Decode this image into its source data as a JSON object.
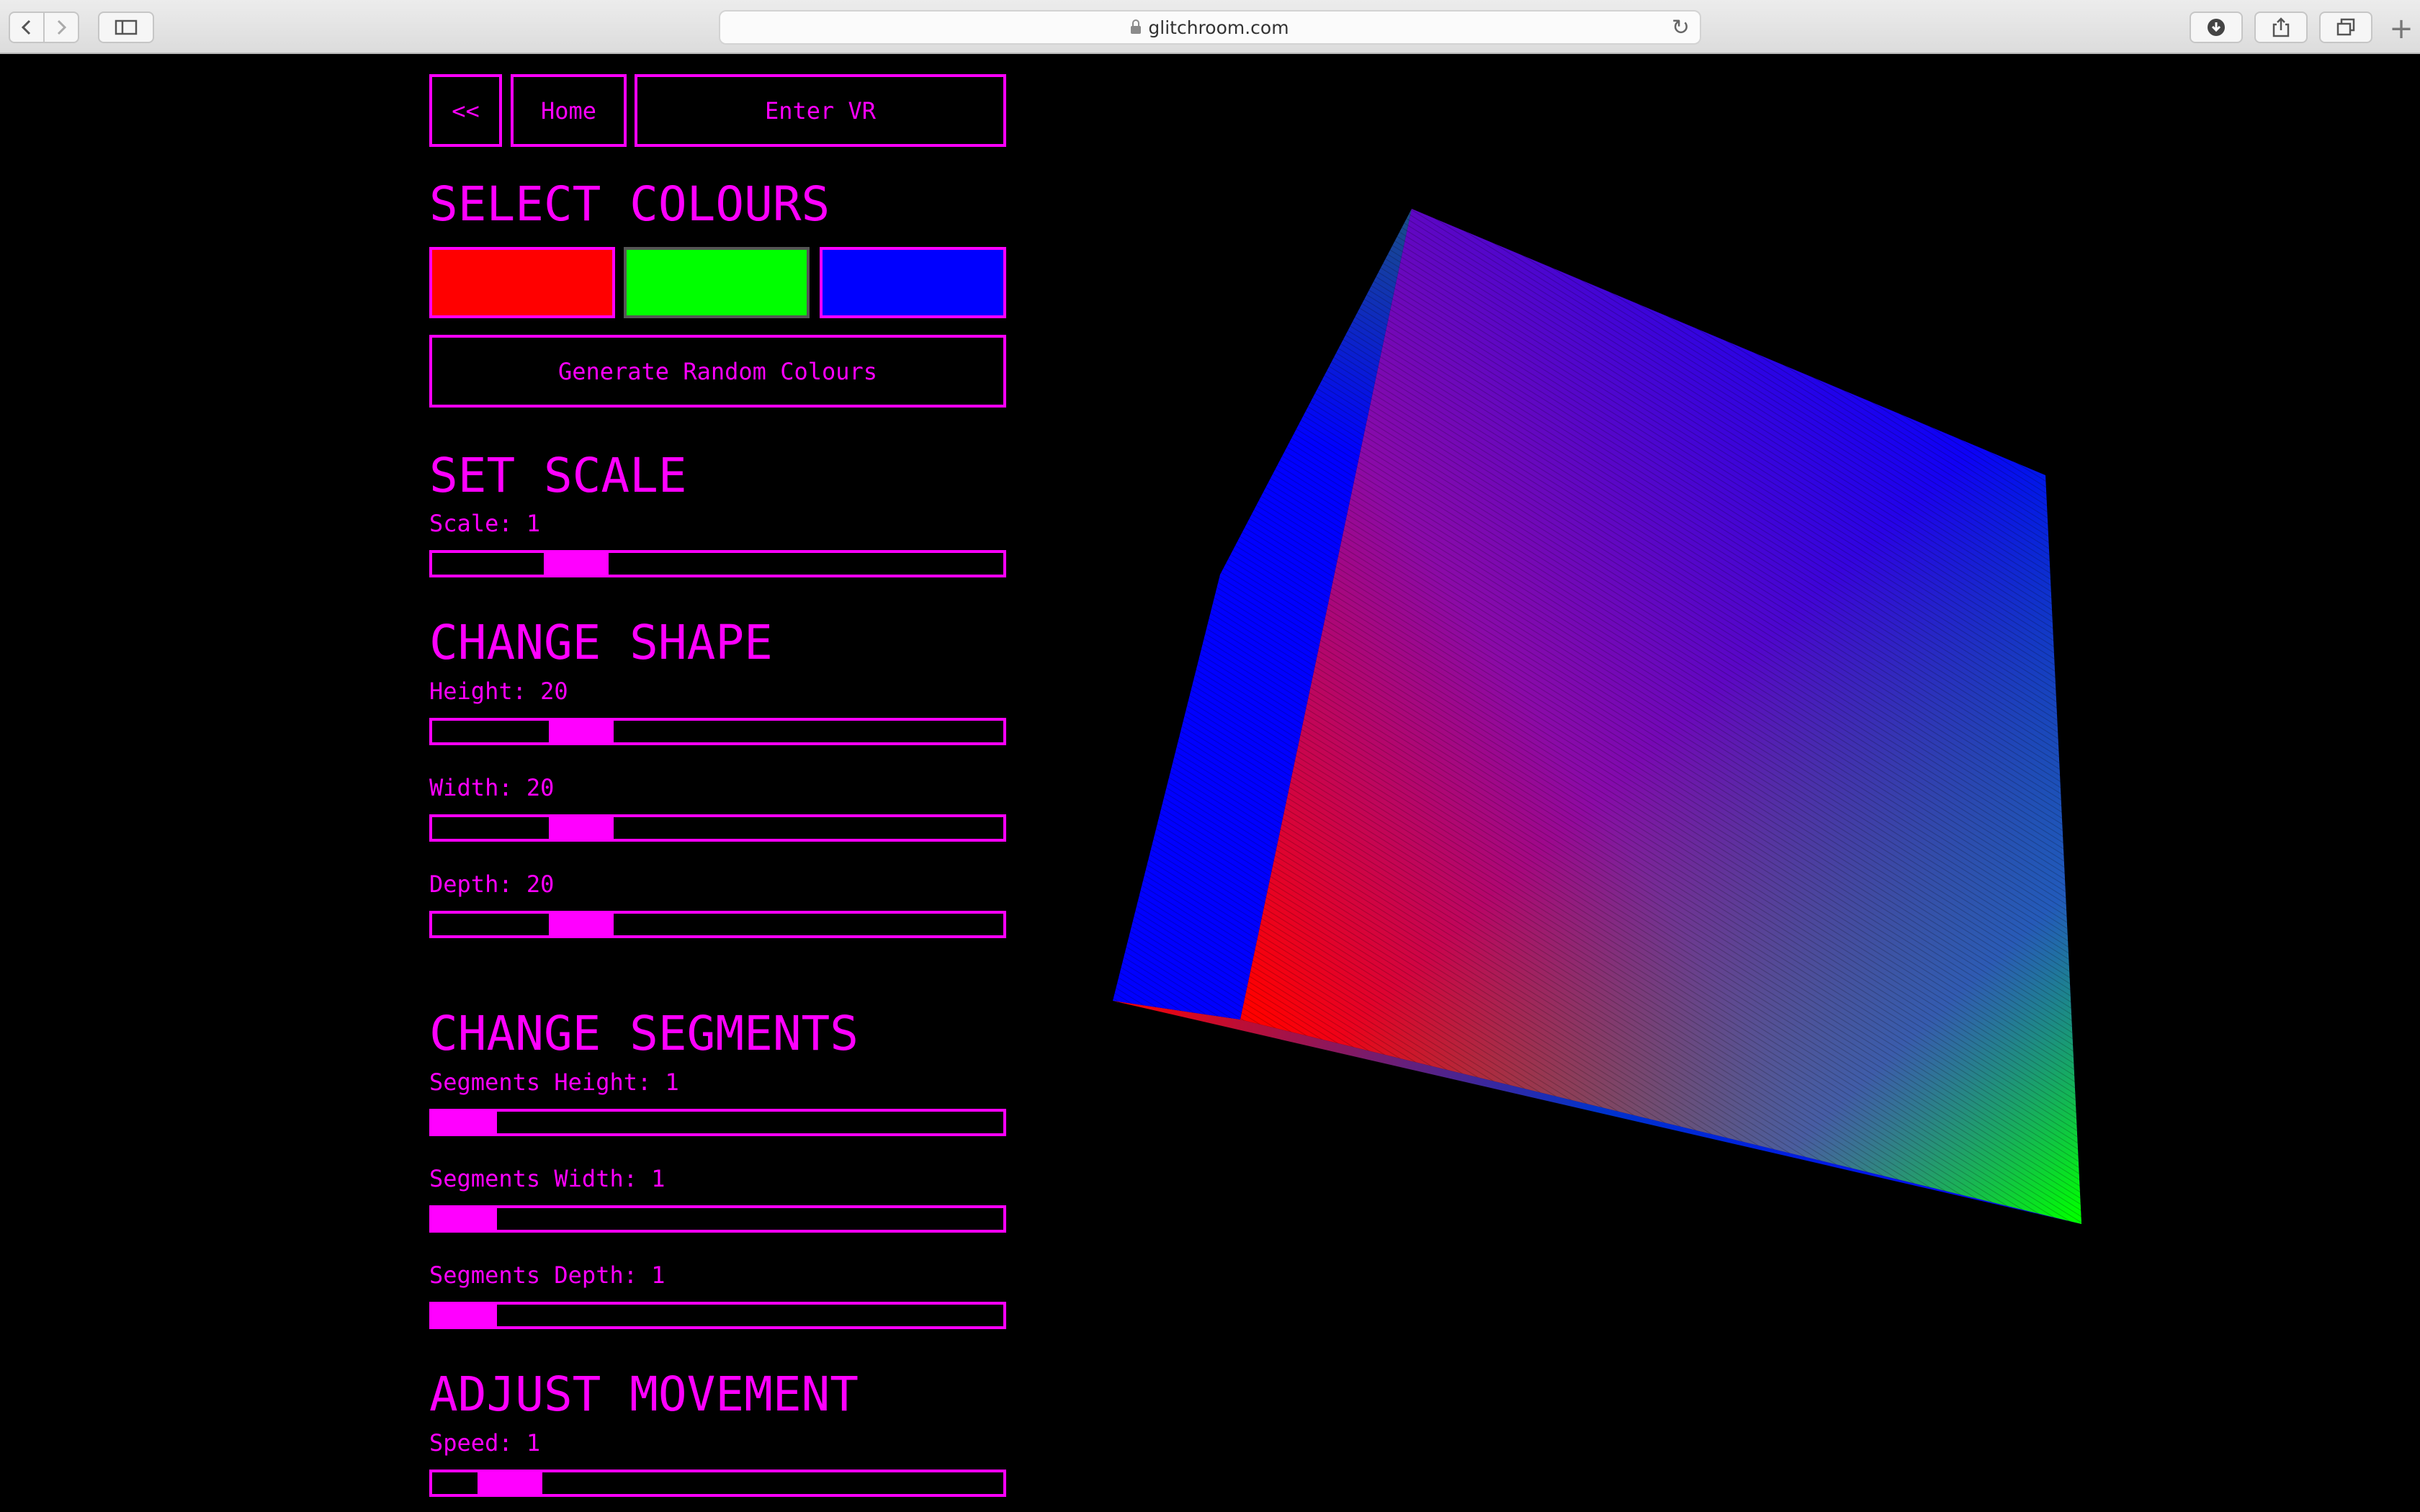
{
  "browser": {
    "url": "glitchroom.com",
    "back_icon": "chevron-left-icon",
    "forward_icon": "chevron-right-icon",
    "sidebar_icon": "sidebar-icon",
    "reload_icon": "reload-icon",
    "download_icon": "download-icon",
    "share_icon": "share-icon",
    "tabs_icon": "tabs-icon",
    "new_tab_icon": "plus-icon"
  },
  "nav": {
    "back_label": "<<",
    "home_label": "Home",
    "vr_label": "Enter VR"
  },
  "colours": {
    "heading": "SELECT COLOURS",
    "swatches": [
      "#ff0000",
      "#00ff00",
      "#0000ff"
    ],
    "random_label": "Generate Random Colours"
  },
  "scale": {
    "heading": "SET SCALE",
    "label": "Scale: 1",
    "value": 0.22
  },
  "shape": {
    "heading": "CHANGE SHAPE",
    "height": {
      "label": "Height: 20",
      "value": 0.23
    },
    "width": {
      "label": "Width: 20",
      "value": 0.23
    },
    "depth": {
      "label": "Depth: 20",
      "value": 0.23
    }
  },
  "segments": {
    "heading": "CHANGE SEGMENTS",
    "height": {
      "label": "Segments Height: 1",
      "value": 0.0
    },
    "width": {
      "label": "Segments Width: 1",
      "value": 0.0
    },
    "depth": {
      "label": "Segments Depth: 1",
      "value": 0.0
    }
  },
  "movement": {
    "heading": "ADJUST MOVEMENT",
    "speed": {
      "label": "Speed: 1",
      "value": 0.09
    }
  },
  "theme": {
    "accent": "#ff00ff",
    "background": "#000000"
  }
}
